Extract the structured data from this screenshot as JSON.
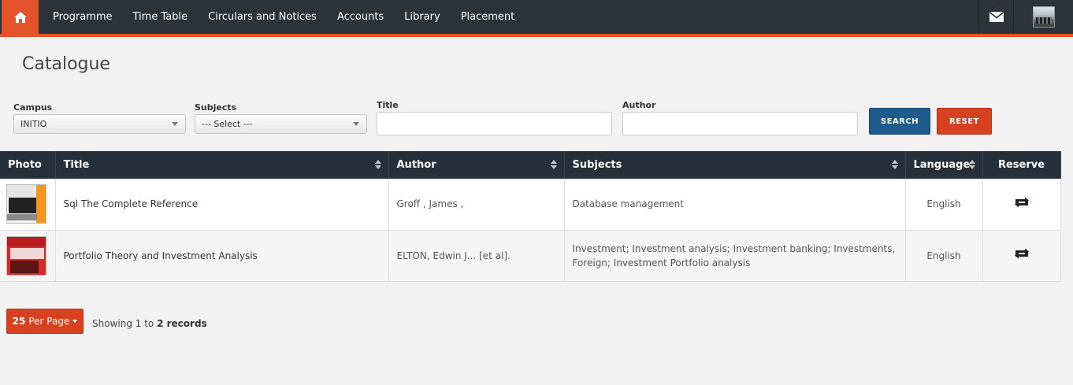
{
  "nav": {
    "items": [
      {
        "label": "Programme"
      },
      {
        "label": "Time Table"
      },
      {
        "label": "Circulars and Notices"
      },
      {
        "label": "Accounts"
      },
      {
        "label": "Library"
      },
      {
        "label": "Placement"
      }
    ],
    "home_icon": "home-icon",
    "mail_icon": "envelope-icon"
  },
  "page": {
    "title": "Catalogue"
  },
  "filters": {
    "campus": {
      "label": "Campus",
      "value": "INITIO"
    },
    "subjects": {
      "label": "Subjects",
      "value": "--- Select ---"
    },
    "title": {
      "label": "Title",
      "value": ""
    },
    "author": {
      "label": "Author",
      "value": ""
    },
    "search_label": "SEARCH",
    "reset_label": "RESET"
  },
  "table": {
    "headers": {
      "photo": "Photo",
      "title": "Title",
      "author": "Author",
      "subjects": "Subjects",
      "language": "Language",
      "reserve": "Reserve"
    },
    "rows": [
      {
        "title": "Sql The Complete Reference",
        "author": "Groff , James ,",
        "subjects": "Database management",
        "language": "English"
      },
      {
        "title": "Portfolio Theory and Investment Analysis",
        "author": "ELTON, Edwin J... [et al].",
        "subjects": "Investment; Investment analysis; Investment banking; Investments, Foreign; Investment Portfolio analysis",
        "language": "English"
      }
    ]
  },
  "pagination": {
    "per_page_count": "25",
    "per_page_suffix": "Per Page",
    "showing_prefix": "Showing 1 to",
    "showing_count": "2 records"
  },
  "colors": {
    "accent": "#e4532c",
    "nav_bg": "#2e333a",
    "header_bg": "#25303b",
    "search_btn": "#1e5c8e",
    "reset_btn": "#d7411f"
  }
}
